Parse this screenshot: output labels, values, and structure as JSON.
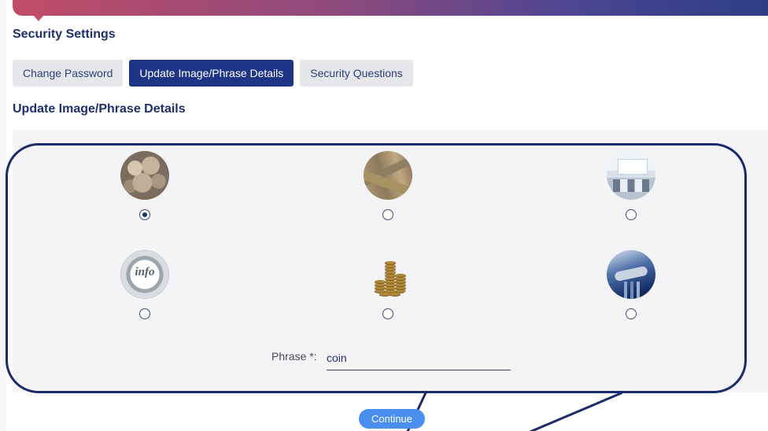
{
  "page": {
    "title": "Security Settings",
    "section_title": "Update Image/Phrase Details"
  },
  "tabs": [
    {
      "label": "Change Password",
      "active": false
    },
    {
      "label": "Update Image/Phrase Details",
      "active": true
    },
    {
      "label": "Security Questions",
      "active": false
    }
  ],
  "images": [
    {
      "icon": "coins-pile-image",
      "selected": true
    },
    {
      "icon": "banknotes-image",
      "selected": false
    },
    {
      "icon": "bank-branch-image",
      "selected": false
    },
    {
      "icon": "info-badge-image",
      "selected": false
    },
    {
      "icon": "coin-stacks-image",
      "selected": false
    },
    {
      "icon": "handshake-image",
      "selected": false
    }
  ],
  "phrase": {
    "label": "Phrase *:",
    "value": "coin"
  },
  "actions": {
    "continue_label": "Continue"
  },
  "colors": {
    "primary": "#1e3484",
    "title": "#1e2f6e",
    "button": "#4a8ff0",
    "tab_inactive": "#e6e7ea",
    "panel": "#f4f4f6",
    "callout": "#1b2a6b"
  }
}
